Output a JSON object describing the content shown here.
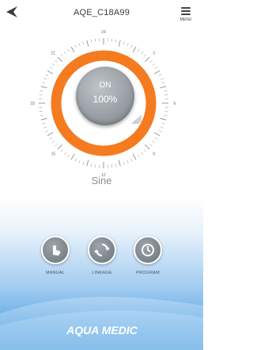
{
  "header": {
    "title": "AQE_C18A99",
    "menu_label": "MENU"
  },
  "dial": {
    "ticks": [
      "24",
      "3",
      "6",
      "9",
      "12",
      "15",
      "18",
      "21"
    ],
    "status": "ON",
    "percent": "100%",
    "level": 1.0
  },
  "mode": "Sine",
  "controls": [
    {
      "label": "MANUAL"
    },
    {
      "label": "LINKAGE"
    },
    {
      "label": "PROGRAM"
    }
  ],
  "brand": {
    "name": "AQUA MEDIC"
  },
  "colors": {
    "accent": "#f47b20",
    "button_gray": "#9aa0a6",
    "bottom_blue": "#3f97df"
  }
}
